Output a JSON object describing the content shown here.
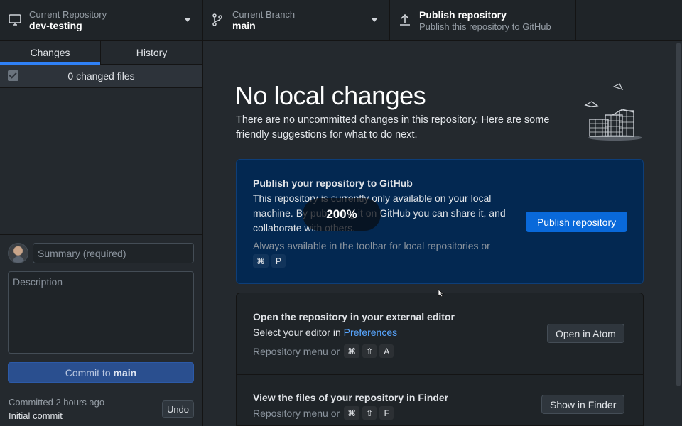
{
  "toolbar": {
    "repository": {
      "label": "Current Repository",
      "value": "dev-testing",
      "icon": "desktop-icon"
    },
    "branch": {
      "label": "Current Branch",
      "value": "main",
      "icon": "git-branch-icon"
    },
    "publish": {
      "title": "Publish repository",
      "subtitle": "Publish this repository to GitHub",
      "icon": "upload-icon"
    }
  },
  "sidebar": {
    "tabs": [
      {
        "label": "Changes",
        "active": true
      },
      {
        "label": "History",
        "active": false
      }
    ],
    "changed_files": "0 changed files",
    "commit": {
      "summary_placeholder": "Summary (required)",
      "description_placeholder": "Description",
      "button_prefix": "Commit to",
      "button_branch": "main"
    },
    "last_commit": {
      "meta": "Committed 2 hours ago",
      "title": "Initial commit",
      "undo_label": "Undo"
    }
  },
  "main": {
    "title": "No local changes",
    "description": "There are no uncommitted changes in this repository. Here are some friendly suggestions for what to do next.",
    "publish_card": {
      "heading": "Publish your repository to GitHub",
      "text": "This repository is currently only available on your local machine. By publishing it on GitHub you can share it, and collaborate with others.",
      "hint": "Always available in the toolbar for local repositories or",
      "keys": [
        "⌘",
        "P"
      ],
      "button_label": "Publish repository"
    },
    "editor_card": {
      "heading": "Open the repository in your external editor",
      "text_prefix": "Select your editor in",
      "link": "Preferences",
      "hint": "Repository menu or",
      "keys": [
        "⌘",
        "⇧",
        "A"
      ],
      "button_label": "Open in Atom"
    },
    "finder_card": {
      "heading": "View the files of your repository in Finder",
      "hint": "Repository menu or",
      "keys": [
        "⌘",
        "⇧",
        "F"
      ],
      "button_label": "Show in Finder"
    }
  },
  "zoom_indicator": "200%",
  "colors": {
    "accent": "#0969da",
    "link": "#58a6ff",
    "publish_card_bg": "#032851"
  }
}
